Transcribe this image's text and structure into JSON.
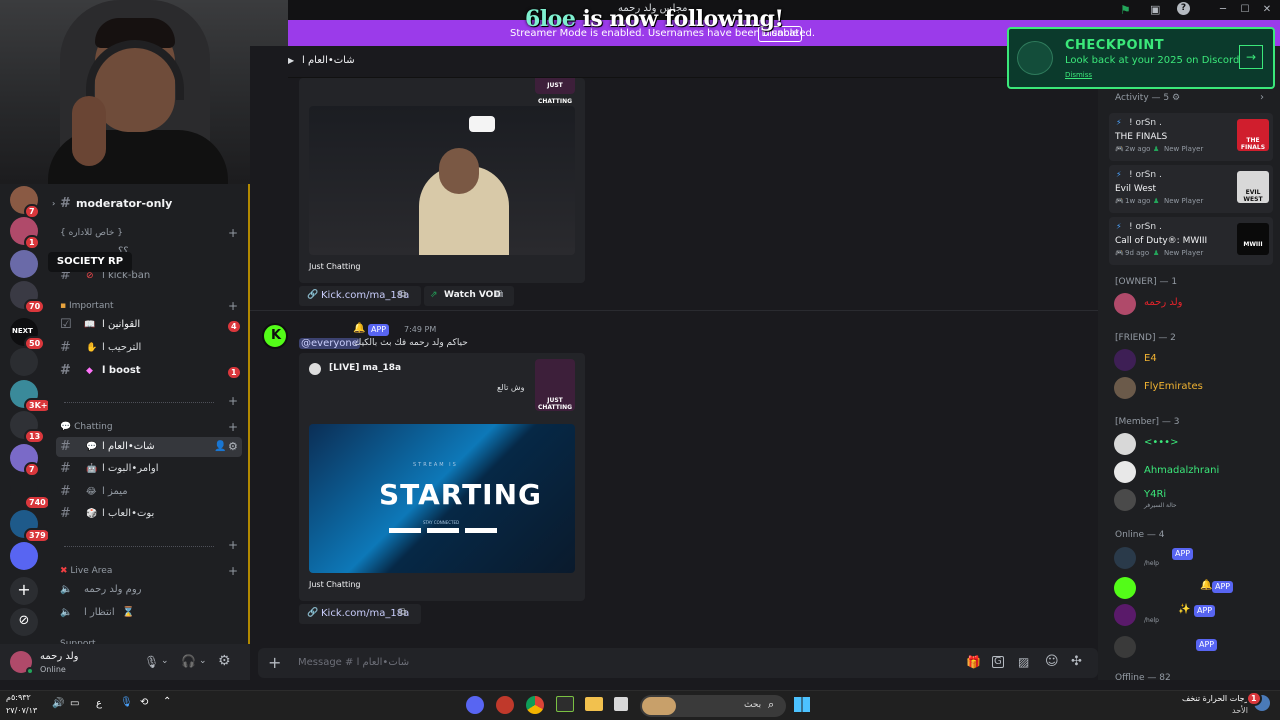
{
  "titlebar": {
    "title": "مجلس ولد رحمه"
  },
  "overlay": {
    "name": "6loe",
    "text": "is now following!"
  },
  "banner": {
    "text": "Streamer Mode is enabled. Usernames have been truncated.",
    "button": "Disable"
  },
  "checkpoint": {
    "title": "CHECKPOINT",
    "subtitle": "Look back at your 2025 on Discord",
    "dismiss": "Dismiss"
  },
  "tooltip": "SOCIETY RP",
  "servers": [
    {
      "badge": "7",
      "color": "#8a5a44"
    },
    {
      "badge": "1",
      "color": "#b04a6a"
    },
    {
      "badge": "",
      "color": "#6a6aa8"
    },
    {
      "badge": "70",
      "color": "#3a3a44"
    },
    {
      "badge": "50",
      "color": "#0e0e10",
      "label": "NEXT"
    },
    {
      "badge": "",
      "color": "#2b2d31"
    },
    {
      "badge": "3K+",
      "color": "#3a8a9a"
    },
    {
      "badge": "13",
      "color": "#2f3136"
    },
    {
      "badge": "7",
      "color": "#7a6ac8"
    },
    {
      "badge": "740",
      "color": "#1e1f22"
    },
    {
      "badge": "379",
      "color": "#1e5a8a"
    },
    {
      "badge": "",
      "color": "#5865f2"
    }
  ],
  "channels": {
    "moderator": "moderator-only",
    "cat_private": "{ خاص للاداره }",
    "hidden_row": "؟؟",
    "kickban": "ا kick-ban",
    "cat_important": "Important",
    "rules": "القوانين ا",
    "rules_badge": "4",
    "welcome": "الترحيب ا",
    "boost": "ا boost",
    "boost_badge": "1",
    "cat_chatting": "Chatting",
    "general": "شات•العام ا",
    "botcmds": "اوامر•البوت ا",
    "features": "ميمز ا",
    "games": "بوت•العاب ا",
    "cat_live": "Live Area",
    "voice1": "روم ولد رحمه",
    "voice2": "انتظار ا",
    "cat_support": "Support"
  },
  "user": {
    "name": "ولد رحمه",
    "status": "Online"
  },
  "chat": {
    "channel_title": "شات•العام ا",
    "embed1": {
      "thumb_label": "JUST CHATTING",
      "category": "Just Chatting",
      "link": "Kick.com/ma_18a",
      "vod": "Watch VOD"
    },
    "msg2": {
      "app": "APP",
      "time": "7:49 PM",
      "mention": "@everyone",
      "text": "حياكم ولد رحمه فك بث بالكيك",
      "live_title": "[LIVE] ma_18a",
      "live_desc": "وش تالع",
      "starting": "STARTING",
      "stream_is": "STREAM IS",
      "stay": "STAY CONNECTED",
      "category": "Just Chatting",
      "link": "Kick.com/ma_18a",
      "thumb_label": "JUST CHATTING"
    },
    "placeholder": "Message # شات•العام ا"
  },
  "members": {
    "activity_header": "Activity — 5",
    "activities": [
      {
        "user": "! orSn .",
        "game": "THE FINALS",
        "ago": "2w ago",
        "tag": "New Player",
        "art": "THE FINALS",
        "color": "#d01e2d"
      },
      {
        "user": "! orSn .",
        "game": "Evil West",
        "ago": "1w ago",
        "tag": "New Player",
        "art": "EVIL WEST",
        "color": "#d8d8d8"
      },
      {
        "user": "! orSn .",
        "game": "Call of Duty®: MWIII",
        "ago": "9d ago",
        "tag": "New Player",
        "art": "MWIII",
        "color": "#0a0a0a"
      }
    ],
    "owner_header": "[OWNER] — 1",
    "owner": "ولد رحمه",
    "friend_header": "[FRIEND] — 2",
    "friends": [
      "E4",
      "FlyEmirates"
    ],
    "member_header": "[Member] — 3",
    "members": [
      "<•••>",
      "Ahmadalzhrani",
      "Y4Ri"
    ],
    "y4ri_status": "حالة السيرفر",
    "online_header": "Online — 4",
    "online_help1": "/help",
    "online_help2": "/help",
    "offline_header": "Offline — 82"
  },
  "taskbar": {
    "search": "بحث",
    "weather": "درجات الحرارة تنخف...",
    "weather_day": "الأحد",
    "clock_time": "٥:٩٣٢م",
    "clock_date": "٢٧/٠٧/١٣",
    "lang": "ع",
    "notif": "1"
  },
  "colors": {
    "accent": "#5865f2",
    "streamer_banner": "#9b3bea",
    "kick_green": "#53fc18",
    "checkpoint": "#3be87a"
  }
}
